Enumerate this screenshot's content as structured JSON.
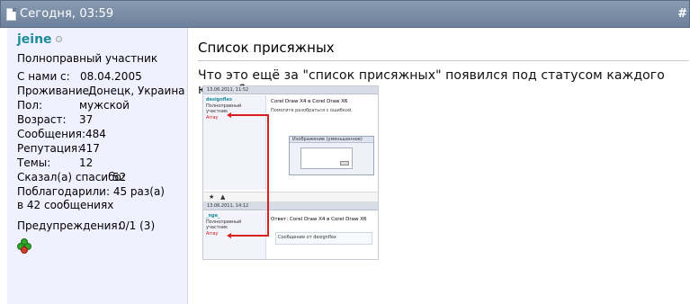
{
  "header": {
    "date": "Сегодня, 03:59",
    "post_number": "#"
  },
  "user": {
    "name": "jeine",
    "rank": "Полноправный участник",
    "fields": [
      {
        "key": "С нами с:",
        "value": "08.04.2005"
      },
      {
        "key": "Проживание:",
        "value": "Донецк, Украина"
      },
      {
        "key": "Пол:",
        "value": "мужской"
      },
      {
        "key": "Возраст:",
        "value": "37"
      },
      {
        "key": "Сообщения:",
        "value": "484"
      },
      {
        "key": "Репутация:",
        "value": "417"
      },
      {
        "key": "Темы:",
        "value": "12"
      }
    ],
    "thanked_label": "Сказал(а) спасибо:",
    "thanked_value": "52",
    "thanks_line1": "Поблагодарили: 45 раз(а)",
    "thanks_line2": "в 42 сообщениях",
    "warnings_label": "Предупреждения:",
    "warnings_value": "0/1 (3)",
    "icon": "clover-icon"
  },
  "post": {
    "title": "Список присяжных",
    "text": "Что это ещё за \"список присяжных\" появился под статусом каждого юзера?"
  },
  "screenshot": {
    "bar1_date": "13.06.2011, 11:52",
    "bar2_date": "13.06.2011, 14:12",
    "user1": "designflex",
    "user2": "_nge_",
    "rank": "Полноправный участник",
    "list_label": "Array",
    "topic1": "Corel Draw X4 в Corel Draw X6",
    "topic2": "Ответ: Corel Draw X4 в Corel Draw X6",
    "body1": "Помогите разобраться с ошибкой.",
    "dialog_title": "Изображение (уменьшенное)",
    "reply_text": "Сообщение от designflex",
    "accent": "#d82020"
  }
}
